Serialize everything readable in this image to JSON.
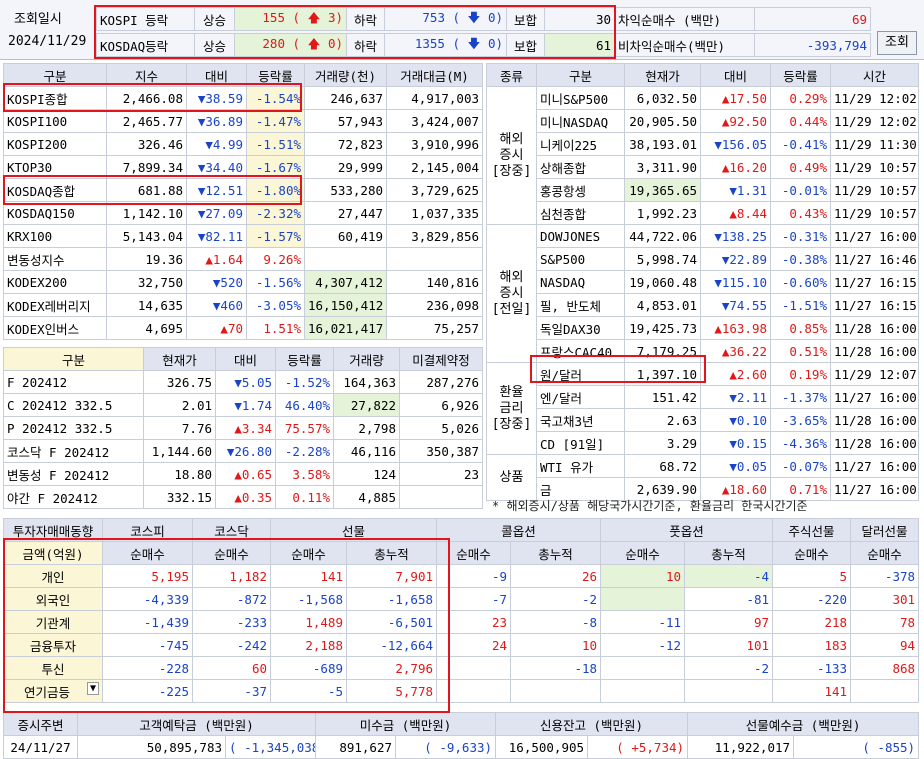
{
  "header": {
    "query_label": "조회일시",
    "date": "2024/11/29",
    "search_button": "조회",
    "rows": [
      {
        "market": "KOSPI 등락",
        "up_label": "상승",
        "up_count": "155",
        "up_limit": "3",
        "down_label": "하락",
        "down_count": "753",
        "down_limit": "0",
        "flat_label": "보합",
        "flat_count": "30"
      },
      {
        "market": "KOSDAQ등락",
        "up_label": "상승",
        "up_count": "280",
        "up_limit": "0",
        "down_label": "하락",
        "down_count": "1355",
        "down_limit": "0",
        "flat_label": "보합",
        "flat_count": "61"
      }
    ],
    "arb": [
      {
        "label": "차익순매수 (백만)",
        "value": "69"
      },
      {
        "label": "비차익순매수(백만)",
        "value": "-393,794"
      }
    ]
  },
  "index_table": {
    "headers": [
      "구분",
      "지수",
      "대비",
      "등락률",
      "거래량(천)",
      "거래대금(M)"
    ],
    "rows": [
      {
        "name": "KOSPI종합",
        "value": "2,466.08",
        "dir": "dn",
        "chg": "38.59",
        "rate": "-1.54%",
        "vol": "246,637",
        "amt": "4,917,003"
      },
      {
        "name": "KOSPI100",
        "value": "2,465.77",
        "dir": "dn",
        "chg": "36.89",
        "rate": "-1.47%",
        "vol": "57,943",
        "amt": "3,424,007"
      },
      {
        "name": "KOSPI200",
        "value": "326.46",
        "dir": "dn",
        "chg": "4.99",
        "rate": "-1.51%",
        "vol": "72,823",
        "amt": "3,910,996"
      },
      {
        "name": "KTOP30",
        "value": "7,899.34",
        "dir": "dn",
        "chg": "34.40",
        "rate": "-1.67%",
        "vol": "29,999",
        "amt": "2,145,004"
      },
      {
        "name": "KOSDAQ종합",
        "value": "681.88",
        "dir": "dn",
        "chg": "12.51",
        "rate": "-1.80%",
        "vol": "533,280",
        "amt": "3,729,625"
      },
      {
        "name": "KOSDAQ150",
        "value": "1,142.10",
        "dir": "dn",
        "chg": "27.09",
        "rate": "-2.32%",
        "vol": "27,447",
        "amt": "1,037,335"
      },
      {
        "name": "KRX100",
        "value": "5,143.04",
        "dir": "dn",
        "chg": "82.11",
        "rate": "-1.57%",
        "vol": "60,419",
        "amt": "3,829,856"
      },
      {
        "name": "변동성지수",
        "value": "19.36",
        "dir": "up",
        "chg": "1.64",
        "rate": "9.26%",
        "vol": "",
        "amt": ""
      },
      {
        "name": "KODEX200",
        "value": "32,750",
        "dir": "dn",
        "chg": "520",
        "rate": "-1.56%",
        "vol": "4,307,412",
        "amt": "140,816"
      },
      {
        "name": "KODEX레버리지",
        "value": "14,635",
        "dir": "dn",
        "chg": "460",
        "rate": "-3.05%",
        "vol": "16,150,412",
        "amt": "236,098"
      },
      {
        "name": "KODEX인버스",
        "value": "4,695",
        "dir": "up",
        "chg": "70",
        "rate": "1.51%",
        "vol": "16,021,417",
        "amt": "75,257"
      }
    ]
  },
  "futures_table": {
    "headers": [
      "구분",
      "현재가",
      "대비",
      "등락률",
      "거래량",
      "미결제약정"
    ],
    "rows": [
      {
        "name": "F 202412",
        "value": "326.75",
        "dir": "dn",
        "chg": "5.05",
        "rate": "-1.52%",
        "vol": "164,363",
        "oi": "287,276"
      },
      {
        "name": "C 202412 332.5",
        "value": "2.01",
        "dir": "dn",
        "chg": "1.74",
        "rate": "46.40%",
        "vol": "27,822",
        "oi": "6,926"
      },
      {
        "name": "P 202412 332.5",
        "value": "7.76",
        "dir": "up",
        "chg": "3.34",
        "rate": "75.57%",
        "vol": "2,798",
        "oi": "5,026"
      },
      {
        "name": "코스닥 F 202412",
        "value": "1,144.60",
        "dir": "dn",
        "chg": "26.80",
        "rate": "-2.28%",
        "vol": "46,116",
        "oi": "350,387"
      },
      {
        "name": "변동성 F 202412",
        "value": "18.80",
        "dir": "up",
        "chg": "0.65",
        "rate": "3.58%",
        "vol": "124",
        "oi": "23"
      },
      {
        "name": "야간 F 202412",
        "value": "332.15",
        "dir": "up",
        "chg": "0.35",
        "rate": "0.11%",
        "vol": "4,885",
        "oi": ""
      }
    ]
  },
  "global_table": {
    "headers": [
      "종류",
      "구분",
      "현재가",
      "대비",
      "등락률",
      "시간"
    ],
    "groups": [
      {
        "label": "해외\n증시\n[장중]",
        "rows": [
          {
            "name": "미니S&P500",
            "value": "6,032.50",
            "dir": "up",
            "chg": "17.50",
            "rate": "0.29%",
            "time": "11/29 12:02"
          },
          {
            "name": "미니NASDAQ",
            "value": "20,905.50",
            "dir": "up",
            "chg": "92.50",
            "rate": "0.44%",
            "time": "11/29 12:02"
          },
          {
            "name": "니케이225",
            "value": "38,193.01",
            "dir": "dn",
            "chg": "156.05",
            "rate": "-0.41%",
            "time": "11/29 11:30"
          },
          {
            "name": "상해종합",
            "value": "3,311.90",
            "dir": "up",
            "chg": "16.20",
            "rate": "0.49%",
            "time": "11/29 10:57"
          },
          {
            "name": "홍콩항셍",
            "value": "19,365.65",
            "dir": "dn",
            "chg": "1.31",
            "rate": "-0.01%",
            "time": "11/29 10:57"
          },
          {
            "name": "심천종합",
            "value": "1,992.23",
            "dir": "up",
            "chg": "8.44",
            "rate": "0.43%",
            "time": "11/29 10:57"
          }
        ]
      },
      {
        "label": "해외\n증시\n[전일]",
        "rows": [
          {
            "name": "DOWJONES",
            "value": "44,722.06",
            "dir": "dn",
            "chg": "138.25",
            "rate": "-0.31%",
            "time": "11/27 16:00"
          },
          {
            "name": "S&P500",
            "value": "5,998.74",
            "dir": "dn",
            "chg": "22.89",
            "rate": "-0.38%",
            "time": "11/27 16:46"
          },
          {
            "name": "NASDAQ",
            "value": "19,060.48",
            "dir": "dn",
            "chg": "115.10",
            "rate": "-0.60%",
            "time": "11/27 16:15"
          },
          {
            "name": "필, 반도체",
            "value": "4,853.01",
            "dir": "dn",
            "chg": "74.55",
            "rate": "-1.51%",
            "time": "11/27 16:15"
          },
          {
            "name": "독일DAX30",
            "value": "19,425.73",
            "dir": "up",
            "chg": "163.98",
            "rate": "0.85%",
            "time": "11/28 16:00"
          },
          {
            "name": "프랑스CAC40",
            "value": "7,179.25",
            "dir": "up",
            "chg": "36.22",
            "rate": "0.51%",
            "time": "11/28 16:00"
          }
        ]
      },
      {
        "label": "환율\n금리\n[장중]",
        "rows": [
          {
            "name": "원/달러",
            "value": "1,397.10",
            "dir": "up",
            "chg": "2.60",
            "rate": "0.19%",
            "time": "11/29 12:07"
          },
          {
            "name": "엔/달러",
            "value": "151.42",
            "dir": "dn",
            "chg": "2.11",
            "rate": "-1.37%",
            "time": "11/27 16:00"
          },
          {
            "name": "국고채3년",
            "value": "2.63",
            "dir": "dn",
            "chg": "0.10",
            "rate": "-3.65%",
            "time": "11/28 16:00"
          },
          {
            "name": "CD [91일]",
            "value": "3.29",
            "dir": "dn",
            "chg": "0.15",
            "rate": "-4.36%",
            "time": "11/28 16:00"
          }
        ]
      },
      {
        "label": "상품",
        "rows": [
          {
            "name": "WTI 유가",
            "value": "68.72",
            "dir": "dn",
            "chg": "0.05",
            "rate": "-0.07%",
            "time": "11/27 16:00"
          },
          {
            "name": "금",
            "value": "2,639.90",
            "dir": "up",
            "chg": "18.60",
            "rate": "0.71%",
            "time": "11/27 16:00"
          }
        ]
      }
    ],
    "note": "* 해외증시/상품 해당국가시간기준, 환율금리 한국시간기준"
  },
  "investor_table": {
    "title": "투자자매매동향",
    "col_kospi": "코스피",
    "col_kosdaq": "코스닥",
    "col_futures": "선물",
    "col_call": "콜옵션",
    "col_put": "풋옵션",
    "col_stock_fut": "주식선물",
    "col_dollar_fut": "달러선물",
    "unit_label": "금액(억원)",
    "sub": [
      "순매수",
      "순매수",
      "순매수",
      "총누적",
      "순매수",
      "총누적",
      "순매수",
      "총누적",
      "순매수",
      "순매수"
    ],
    "rows": [
      {
        "name": "개인",
        "v": [
          "5,195",
          "1,182",
          "141",
          "7,901",
          "-9",
          "26",
          "10",
          "-4",
          "5",
          "-378"
        ]
      },
      {
        "name": "외국인",
        "v": [
          "-4,339",
          "-872",
          "-1,568",
          "-1,658",
          "-7",
          "-2",
          "",
          "-81",
          "-220",
          "301"
        ]
      },
      {
        "name": "기관계",
        "v": [
          "-1,439",
          "-233",
          "1,489",
          "-6,501",
          "23",
          "-8",
          "-11",
          "97",
          "218",
          "78"
        ]
      },
      {
        "name": "금융투자",
        "v": [
          "-745",
          "-242",
          "2,188",
          "-12,664",
          "24",
          "10",
          "-12",
          "101",
          "183",
          "94"
        ]
      },
      {
        "name": "투신",
        "v": [
          "-228",
          "60",
          "-689",
          "2,796",
          "",
          "-18",
          "",
          "-2",
          "-133",
          "868"
        ]
      },
      {
        "name": "연기금등",
        "v": [
          "-225",
          "-37",
          "-5",
          "5,778",
          "",
          "",
          "",
          "",
          "141",
          ""
        ]
      }
    ]
  },
  "bottom": {
    "headers": [
      "증시주변",
      "고객예탁금 (백만원)",
      "미수금 (백만원)",
      "신용잔고 (백만원)",
      "선물예수금 (백만원)"
    ],
    "date": "24/11/27",
    "deposit": "50,895,783",
    "deposit_chg": "-1,345,038",
    "unpaid": "891,627",
    "unpaid_chg": "-9,633",
    "credit": "16,500,905",
    "credit_chg": "+5,734",
    "fut_dep": "11,922,017",
    "fut_dep_chg": "-855"
  }
}
